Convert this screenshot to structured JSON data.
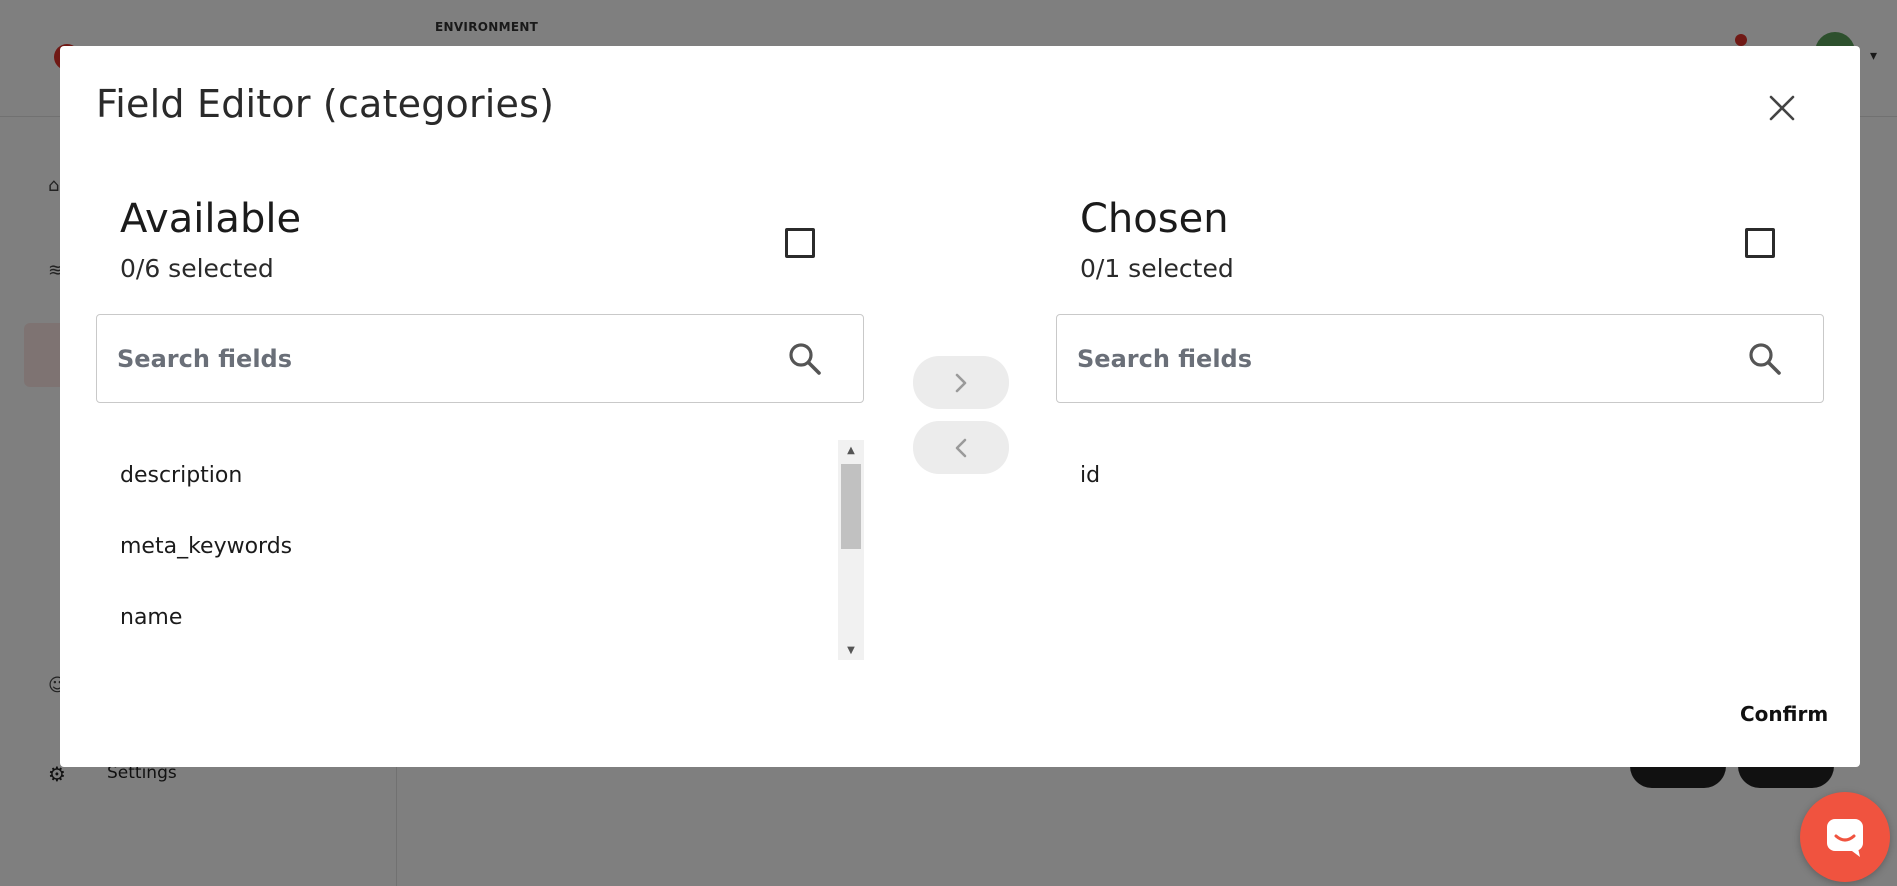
{
  "background": {
    "environment_label": "ENVIRONMENT",
    "sidebar_settings_label": "Settings"
  },
  "modal": {
    "title": "Field Editor (categories)",
    "close_icon": "close-icon",
    "confirm_label": "Confirm"
  },
  "available": {
    "heading": "Available",
    "count_text": "0/6 selected",
    "search_placeholder": "Search fields",
    "items": [
      {
        "label": "description"
      },
      {
        "label": "meta_keywords"
      },
      {
        "label": "name"
      }
    ]
  },
  "chosen": {
    "heading": "Chosen",
    "count_text": "0/1 selected",
    "search_placeholder": "Search fields",
    "items": [
      {
        "label": "id"
      }
    ]
  },
  "transfer": {
    "move_right_icon": "chevron-right-icon",
    "move_left_icon": "chevron-left-icon"
  },
  "colors": {
    "accent": "#f0533f",
    "button_bg": "#ececec"
  }
}
